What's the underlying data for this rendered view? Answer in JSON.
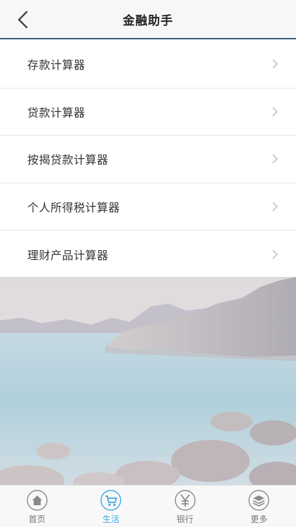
{
  "header": {
    "title": "金融助手",
    "back_icon": "chevron-left-icon"
  },
  "menu": [
    {
      "label": "存款计算器"
    },
    {
      "label": "贷款计算器"
    },
    {
      "label": "按揭贷款计算器"
    },
    {
      "label": "个人所得税计算器"
    },
    {
      "label": "理财产品计算器"
    }
  ],
  "tabs": [
    {
      "label": "首页",
      "icon": "home-icon",
      "active": false
    },
    {
      "label": "生活",
      "icon": "shopping-cart-icon",
      "active": true
    },
    {
      "label": "银行",
      "icon": "yen-icon",
      "active": false
    },
    {
      "label": "更多",
      "icon": "layers-icon",
      "active": false
    }
  ],
  "colors": {
    "accent": "#3fa9e6",
    "header_border": "#3b5a7a",
    "text": "#333333",
    "divider": "#e6e6e6"
  }
}
